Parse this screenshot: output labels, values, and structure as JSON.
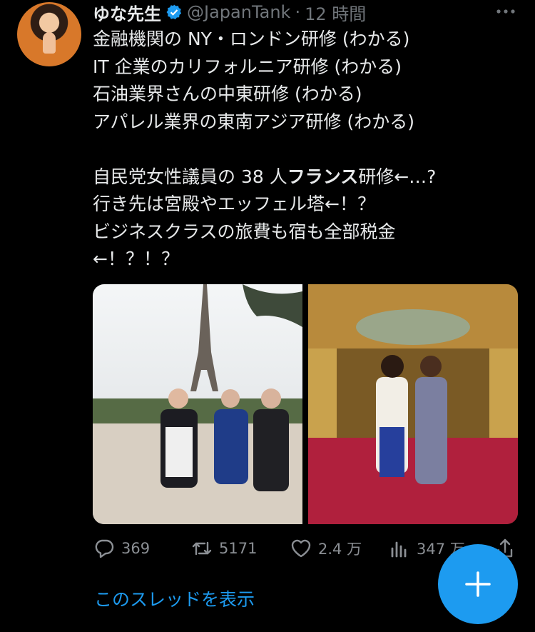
{
  "tweet": {
    "author_name": "ゆな先生",
    "handle": "@JapanTank",
    "separator": "·",
    "time": "12 時間",
    "body_part1": "金融機関の NY・ロンドン研修 (わかる)\nIT 企業のカリフォルニア研修 (わかる)\n石油業界さんの中東研修 (わかる)\nアパレル業界の東南アジア研修 (わかる)\n\n自民党女性議員の 38 人",
    "body_bold": "フランス",
    "body_part2": "研修←…?\n行き先は宮殿やエッフェル塔←！？\nビジネスクラスの旅費も宿も全部税金\n←！？！？"
  },
  "actions": {
    "replies": "369",
    "retweets": "5171",
    "likes": "2.4 万",
    "views": "347 万"
  },
  "thread_link": "このスレッドを表示",
  "icons": {
    "verified": "verified-badge-icon",
    "more": "more-icon",
    "reply": "reply-icon",
    "retweet": "retweet-icon",
    "like": "heart-icon",
    "views": "views-icon",
    "share": "share-icon",
    "compose": "plus-icon"
  },
  "colors": {
    "background": "#000000",
    "text": "#e7e9ea",
    "secondary": "#71767b",
    "accent": "#1d9bf0"
  }
}
